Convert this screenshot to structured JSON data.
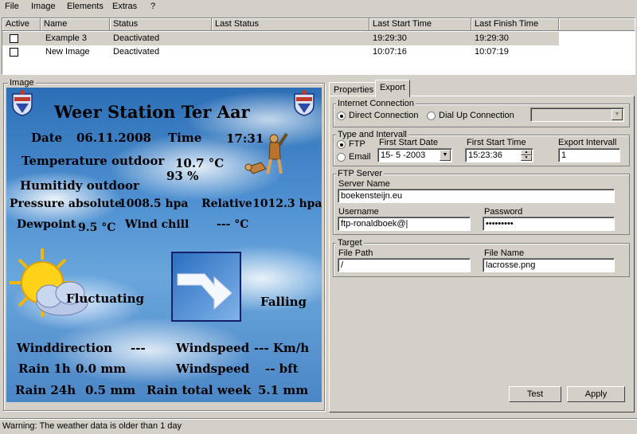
{
  "menu": [
    "File",
    "Image",
    "Elements",
    "Extras",
    "?"
  ],
  "tasks": {
    "columns": [
      "Active",
      "Name",
      "Status",
      "Last Status",
      "Last Start Time",
      "Last Finish Time"
    ],
    "rows": [
      {
        "active": false,
        "name": "Example 3",
        "status": "Deactivated",
        "last_status": "",
        "last_start": "19:29:30",
        "last_finish": "19:29:30",
        "selected": true
      },
      {
        "active": false,
        "name": "New Image",
        "status": "Deactivated",
        "last_status": "",
        "last_start": "10:07:16",
        "last_finish": "10:07:19",
        "selected": false
      }
    ]
  },
  "image_group": {
    "label": "Image",
    "weather": {
      "title": "Weer Station Ter Aar",
      "date_label": "Date",
      "date": "06.11.2008",
      "time_label": "Time",
      "time": "17:31",
      "temp_label": "Temperature outdoor",
      "temp": "10.7 °C",
      "humidity": "93 %",
      "humidity_label": "Humitidy outdoor",
      "pressure_label": "Pressure absolute",
      "pressure": "1008.5 hpa",
      "relative_label": "Relative",
      "relative": "1012.3 hpa",
      "dewpoint_label": "Dewpoint",
      "dewpoint": "9.5 °C",
      "windchill_label": "Wind chill",
      "windchill": "--- °C",
      "forecast": "Fluctuating",
      "trend": "Falling",
      "winddir_label": "Winddirection",
      "winddir": "---",
      "windspeed_label": "Windspeed",
      "windspeed_kmh": "--- Km/h",
      "windspeed_label2": "Windspeed",
      "windspeed_bft": "-- bft",
      "rain1h_label": "Rain 1h",
      "rain1h": "0.0 mm",
      "rain24h_label": "Rain 24h",
      "rain24h": "0.5 mm",
      "rainweek_label": "Rain total week",
      "rainweek": "5.1 mm"
    }
  },
  "tabs": [
    "Properties",
    "Export"
  ],
  "active_tab": "Export",
  "export": {
    "internet": {
      "label": "Internet Connection",
      "direct": "Direct Connection",
      "dialup": "Dial Up Connection",
      "dialup_value": ""
    },
    "type_interval": {
      "label": "Type and Intervall",
      "ftp": "FTP",
      "email": "Email",
      "first_date_label": "First Start Date",
      "first_date": "15- 5 -2003",
      "first_time_label": "First Start Time",
      "first_time": "15:23:36",
      "interval_label": "Export Intervall",
      "interval": "1"
    },
    "ftp_server": {
      "label": "FTP Server",
      "server_label": "Server Name",
      "server": "boekensteijn.eu",
      "user_label": "Username",
      "user": "ftp-ronaldboek@|",
      "pass_label": "Password",
      "pass": "•••••••••"
    },
    "target": {
      "label": "Target",
      "path_label": "File Path",
      "path": "/",
      "file_label": "File Name",
      "file": "lacrosse.png"
    },
    "test_button": "Test",
    "apply_button": "Apply"
  },
  "status_bar": "Warning: The weather data is older than 1 day"
}
